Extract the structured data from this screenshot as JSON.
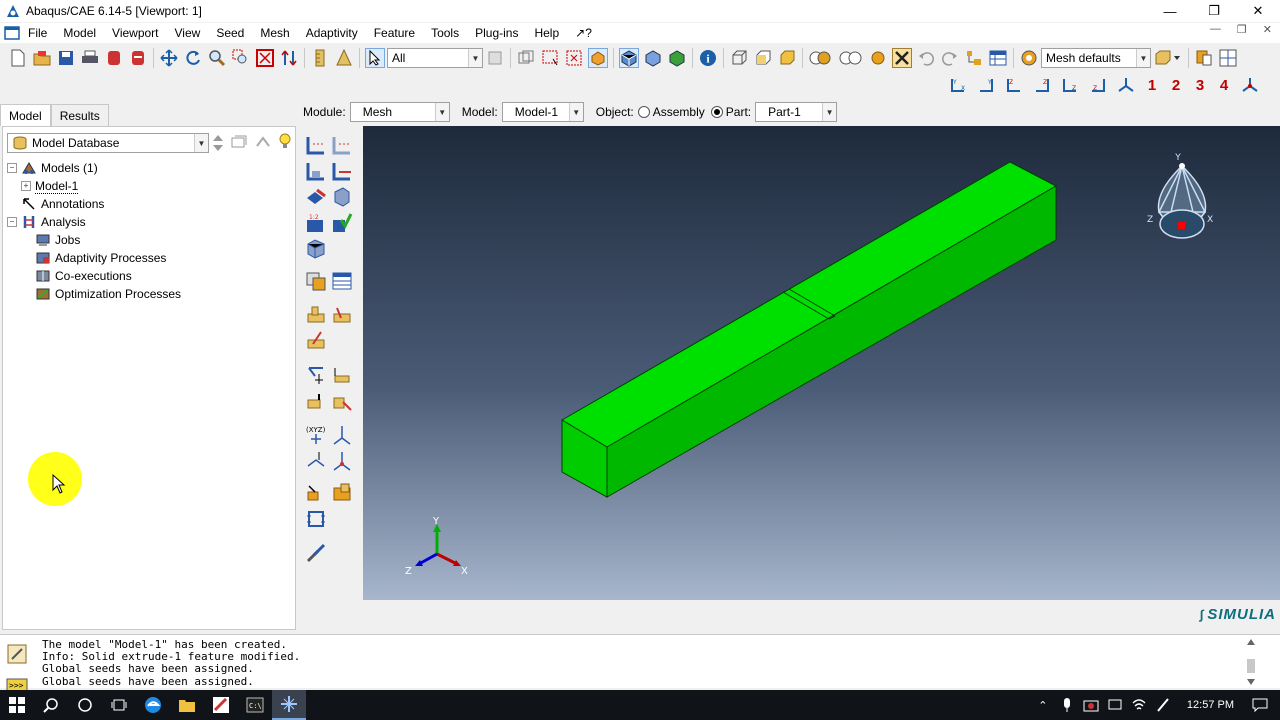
{
  "window": {
    "title": "Abaqus/CAE 6.14-5 [Viewport: 1]"
  },
  "menu": [
    "File",
    "Model",
    "Viewport",
    "View",
    "Seed",
    "Mesh",
    "Adaptivity",
    "Feature",
    "Tools",
    "Plug-ins",
    "Help",
    "↗?"
  ],
  "toolbar": {
    "selection_filter": "All",
    "mesh_defaults": "Mesh defaults",
    "views": [
      "1",
      "2",
      "3",
      "4"
    ]
  },
  "tabs": [
    "Model",
    "Results"
  ],
  "tree": {
    "database": "Model Database",
    "items": [
      {
        "label": "Models (1)",
        "level": 0,
        "expander": "−"
      },
      {
        "label": "Model-1",
        "level": 1,
        "expander": "+"
      },
      {
        "label": "Annotations",
        "level": 0,
        "expander": ""
      },
      {
        "label": "Analysis",
        "level": 0,
        "expander": "−"
      },
      {
        "label": "Jobs",
        "level": 1,
        "expander": ""
      },
      {
        "label": "Adaptivity Processes",
        "level": 1,
        "expander": ""
      },
      {
        "label": "Co-executions",
        "level": 1,
        "expander": ""
      },
      {
        "label": "Optimization Processes",
        "level": 1,
        "expander": ""
      }
    ]
  },
  "context": {
    "module_label": "Module:",
    "module": "Mesh",
    "model_label": "Model:",
    "model": "Model-1",
    "object_label": "Object:",
    "assembly": "Assembly",
    "part_label": "Part:",
    "part": "Part-1"
  },
  "triad": {
    "x": "X",
    "y": "Y",
    "z": "Z"
  },
  "brand": "SIMULIA",
  "messages": [
    "The model \"Model-1\" has been created.",
    "Info: Solid extrude-1 feature modified.",
    "Global seeds have been assigned.",
    "Global seeds have been assigned."
  ],
  "clock": "12:57 PM",
  "colors": {
    "part": "#00e000",
    "part_side": "#00b800",
    "part_dark": "#009a00",
    "view_number": "#c00000"
  }
}
